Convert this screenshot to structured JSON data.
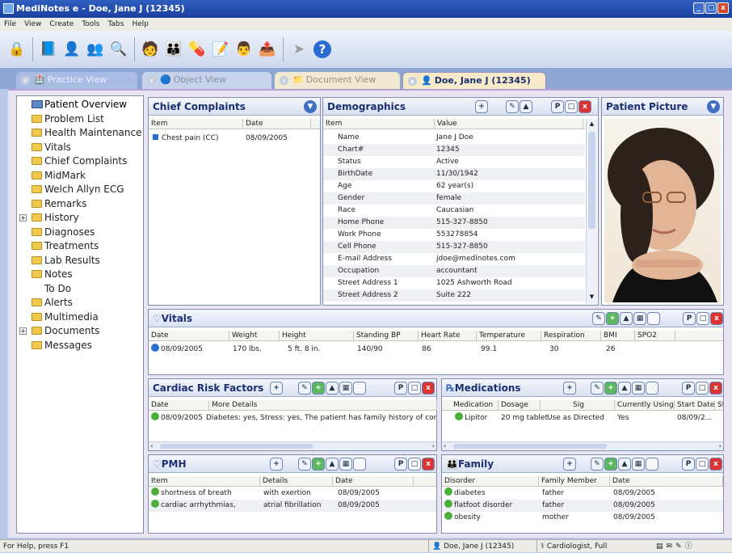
{
  "window": {
    "title": "MediNotes e - Doe, Jane J (12345)",
    "min": "_",
    "max": "□",
    "close": "x"
  },
  "menu": [
    "File",
    "View",
    "Create",
    "Tools",
    "Tabs",
    "Help"
  ],
  "toolbar_icons": [
    "lock-icon",
    "patient-book-icon",
    "user-icon",
    "users-group-icon",
    "document-search-icon",
    "add-user-icon",
    "users-icon",
    "pills-icon",
    "note-edit-icon",
    "user-check-icon",
    "export-icon",
    "arrow-icon",
    "help-icon"
  ],
  "tabs": [
    {
      "label": "Practice View"
    },
    {
      "label": "Object View"
    },
    {
      "label": "Document View"
    },
    {
      "label": "Doe, Jane J (12345)"
    }
  ],
  "nav": [
    {
      "label": "Patient Overview"
    },
    {
      "label": "Problem List"
    },
    {
      "label": "Health Maintenance"
    },
    {
      "label": "Vitals"
    },
    {
      "label": "Chief Complaints"
    },
    {
      "label": "MidMark"
    },
    {
      "label": "Welch Allyn ECG"
    },
    {
      "label": "Remarks"
    },
    {
      "label": "History"
    },
    {
      "label": "Diagnoses"
    },
    {
      "label": "Treatments"
    },
    {
      "label": "Lab Results"
    },
    {
      "label": "Notes"
    },
    {
      "label": "To Do"
    },
    {
      "label": "Alerts"
    },
    {
      "label": "Multimedia"
    },
    {
      "label": "Documents"
    },
    {
      "label": "Messages"
    }
  ],
  "chief_complaints": {
    "title": "Chief Complaints",
    "cols": [
      "Item",
      "Date"
    ],
    "rows": [
      {
        "item": "Chest pain (CC)",
        "date": "08/09/2005"
      }
    ]
  },
  "demographics": {
    "title": "Demographics",
    "cols": [
      "Item",
      "Value"
    ],
    "rows": [
      {
        "item": "Name",
        "value": "Jane J Doe"
      },
      {
        "item": "Chart#",
        "value": "12345"
      },
      {
        "item": "Status",
        "value": "Active"
      },
      {
        "item": "BirthDate",
        "value": "11/30/1942"
      },
      {
        "item": "Age",
        "value": "62 year(s)"
      },
      {
        "item": "Gender",
        "value": "female"
      },
      {
        "item": "Race",
        "value": "Caucasian"
      },
      {
        "item": "Home Phone",
        "value": "515-327-8850"
      },
      {
        "item": "Work Phone",
        "value": "553278854"
      },
      {
        "item": "Cell Phone",
        "value": "515-327-8850"
      },
      {
        "item": "E-mail Address",
        "value": "jdoe@medinotes.com"
      },
      {
        "item": "Occupation",
        "value": "accountant"
      },
      {
        "item": "Street Address 1",
        "value": "1025 Ashworth Road"
      },
      {
        "item": "Street Address 2",
        "value": "Suite 222"
      }
    ]
  },
  "patient_picture": {
    "title": "Patient Picture"
  },
  "vitals": {
    "title": "Vitals",
    "cols": [
      "Date",
      "Weight",
      "Height",
      "Standing BP",
      "Heart Rate",
      "Temperature",
      "Respiration",
      "BMI",
      "SPO2"
    ],
    "rows": [
      {
        "date": "08/09/2005",
        "weight": "170 lbs.",
        "height": "5 ft. 8 in.",
        "bp": "140/90",
        "hr": "86",
        "temp": "99.1",
        "resp": "30",
        "bmi": "26",
        "spo2": ""
      }
    ]
  },
  "cardiac": {
    "title": "Cardiac Risk Factors",
    "cols": [
      "Date",
      "More Details"
    ],
    "rows": [
      {
        "date": "08/09/2005",
        "details": "Diabetes: yes, Stress: yes, The patient has family history of coro"
      }
    ]
  },
  "medications": {
    "title": "Medications",
    "cols": [
      "Medication",
      "Dosage",
      "Sig",
      "Currently Using",
      "Start Date",
      "Sto"
    ],
    "rows": [
      {
        "med": "Lipitor",
        "dosage": "20 mg tablet",
        "sig": "Use as Directed",
        "current": "Yes",
        "start": "08/09/2..."
      }
    ]
  },
  "pmh": {
    "title": "PMH",
    "cols": [
      "Item",
      "Details",
      "Date"
    ],
    "rows": [
      {
        "item": "shortness of breath",
        "details": "with exertion",
        "date": "08/09/2005"
      },
      {
        "item": "cardiac arrhythmias,",
        "details": "atrial fibrillation",
        "date": "08/09/2005"
      }
    ]
  },
  "family": {
    "title": "Family",
    "cols": [
      "Disorder",
      "Family Member",
      "Date"
    ],
    "rows": [
      {
        "disorder": "diabetes",
        "member": "father",
        "date": "08/09/2005"
      },
      {
        "disorder": "flatfoot disorder",
        "member": "father",
        "date": "08/09/2005"
      },
      {
        "disorder": "obesity",
        "member": "mother",
        "date": "08/09/2005"
      }
    ]
  },
  "status": {
    "help": "For Help, press F1",
    "patient": "Doe, Jane J (12345)",
    "user": "Cardiologist, Full"
  },
  "colors": {
    "title_bar": "#1a3f9c",
    "tab_active": "#f6eacb",
    "accent": "#3f6ec2"
  }
}
